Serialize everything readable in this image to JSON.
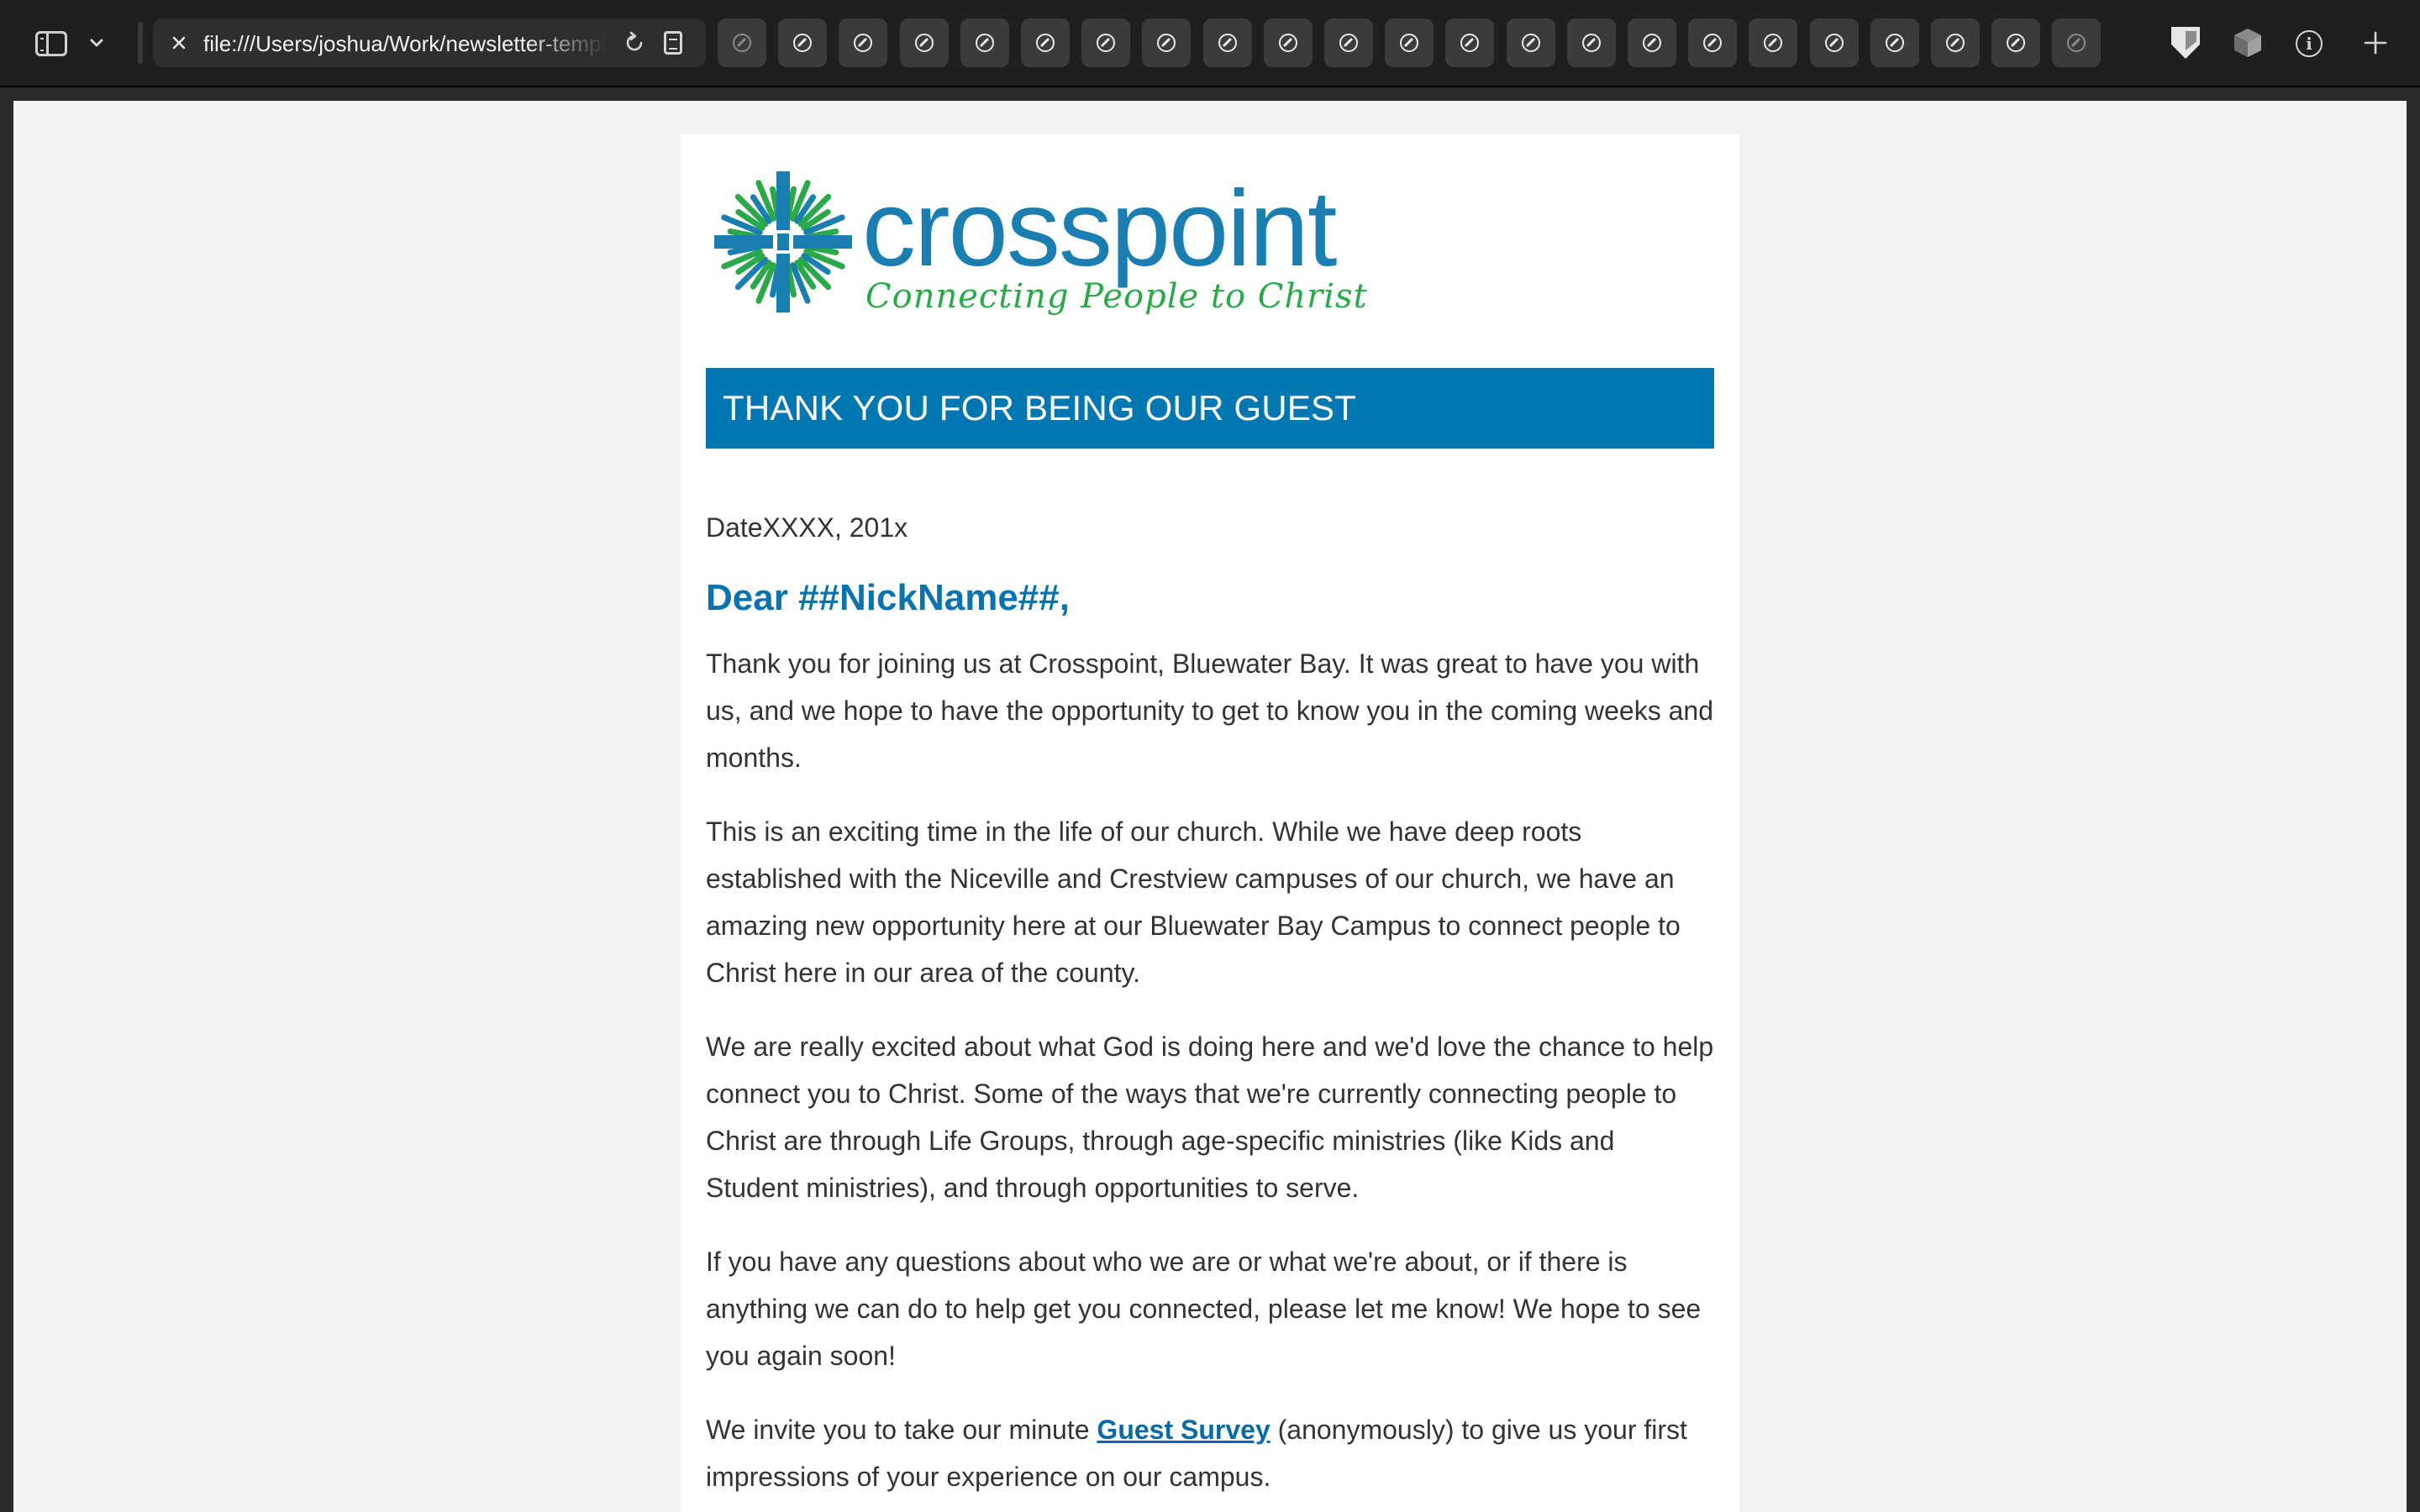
{
  "browser": {
    "url": "file:///Users/joshua/Work/newsletter-templates/guest-thank-you.html",
    "tab_count": 23
  },
  "logo": {
    "wordmark": "crosspoint",
    "tagline": "Connecting People to Christ",
    "colors": {
      "blue": "#1a7fb0",
      "green": "#2aa84a"
    }
  },
  "email": {
    "banner_title": "THANK YOU FOR BEING OUR GUEST",
    "date": "DateXXXX, 201x",
    "greeting": "Dear ##NickName##,",
    "paragraphs": [
      "Thank you for joining us at Crosspoint, Bluewater Bay. It was great to have you with us, and we hope to have the opportunity to get to know you in the coming weeks and months.",
      "This is an exciting time in the life of our church. While we have deep roots established with the Niceville and Crestview campuses of our church, we have an amazing new opportunity here at our Bluewater Bay Campus to connect people to Christ here in our area of the county.",
      "We are really excited about what God is doing here and we'd love the chance to help connect you to Christ. Some of the ways that we're currently connecting people to Christ are through Life Groups, through age-specific ministries (like Kids and Student ministries), and through opportunities to serve.",
      "If you have any questions about who we are or what we're about, or if there is anything we can do to help get you connected, please let me know! We hope to see you again soon!"
    ],
    "survey": {
      "before": "We invite you to take our minute ",
      "link_text": "Guest Survey",
      "after": " (anonymously) to give us your first impressions of your experience on our campus."
    }
  },
  "colors": {
    "banner": "#0077b0",
    "greeting": "#0a73ad",
    "page_bg": "#f2f2f2",
    "toolbar_bg": "#1f1f21"
  }
}
